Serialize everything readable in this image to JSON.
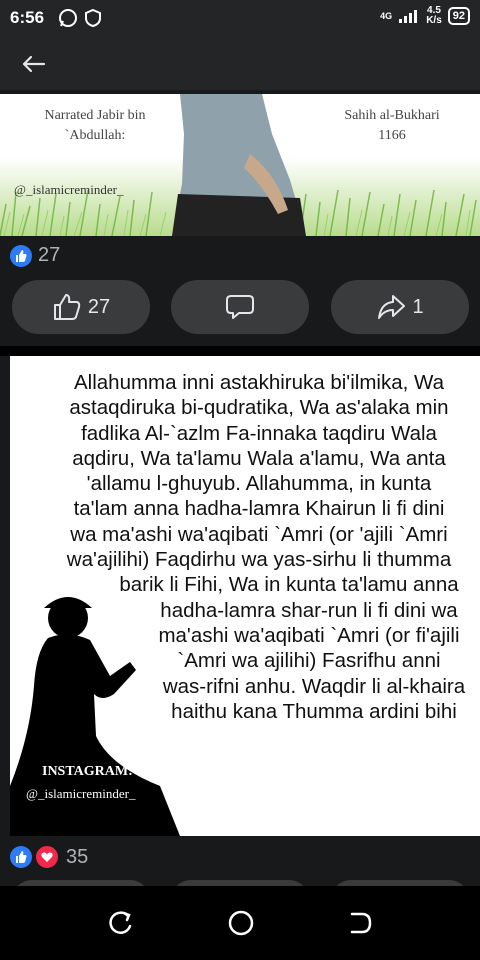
{
  "status": {
    "time": "6:56",
    "network": "4G",
    "speed_value": "4.5",
    "speed_unit": "K/s",
    "battery": "92"
  },
  "post1": {
    "image": {
      "narrated_line1": "Narrated Jabir bin",
      "narrated_line2": "`Abdullah:",
      "source_line1": "Sahih al-Bukhari",
      "source_line2": "1166",
      "handle": "@_islamicreminder_"
    },
    "reaction_count": "27",
    "actions": {
      "like_count": "27",
      "share_count": "1"
    }
  },
  "post2": {
    "dua_lines": [
      "Allahumma inni astakhiruka bi'ilmika, Wa",
      "astaqdiruka bi-qudratika, Wa as'alaka min",
      "fadlika Al-`azlm Fa-innaka taqdiru Wala",
      "aqdiru, Wa ta'lamu Wala a'lamu, Wa anta",
      "'allamu l-ghuyub. Allahumma, in kunta",
      "ta'lam anna hadha-lamra Khairun li fi dini",
      "wa ma'ashi wa'aqibati `Amri (or 'ajili `Amri",
      "wa'ajilihi) Faqdirhu wa yas-sirhu li thumma",
      "barik li Fihi, Wa in kunta ta'lamu anna",
      "hadha-lamra shar-run li fi dini wa",
      "ma'ashi wa'aqibati `Amri (or fi'ajili",
      "`Amri wa ajilihi) Fasrifhu anni",
      "was-rifni anhu. Waqdir li al-khaira",
      "haithu kana Thumma ardini bihi"
    ],
    "instagram_label": "INSTAGRAM:",
    "instagram_handle": "@_islamicreminder_",
    "reaction_count": "35"
  },
  "icons": [
    "back-arrow-icon",
    "like-icon",
    "comment-icon",
    "share-icon",
    "recent-apps-icon",
    "home-icon",
    "back-nav-icon"
  ],
  "colors": {
    "background": "#18191a",
    "surface": "#242526",
    "button": "#3a3b3c",
    "like_blue": "#2e7bf6",
    "love_red": "#f0284a"
  }
}
